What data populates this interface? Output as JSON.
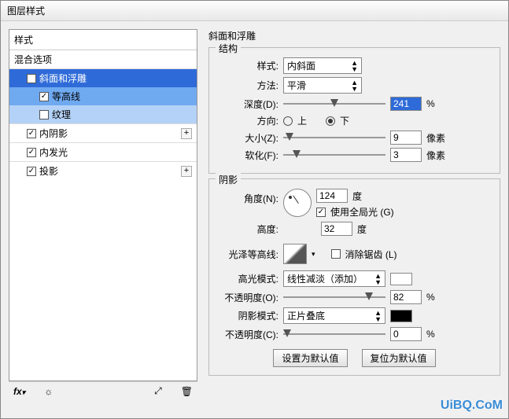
{
  "title": "图层样式",
  "left": {
    "header": "样式",
    "blend": "混合选项",
    "items": [
      {
        "label": "斜面和浮雕",
        "checked": true,
        "cls": "sel1 indent"
      },
      {
        "label": "等高线",
        "checked": true,
        "cls": "sel2 indent2"
      },
      {
        "label": "纹理",
        "checked": false,
        "cls": "sel3 indent2"
      },
      {
        "label": "内阴影",
        "checked": true,
        "cls": "sep indent",
        "plus": true
      },
      {
        "label": "内发光",
        "checked": true,
        "cls": "sep indent"
      },
      {
        "label": "投影",
        "checked": true,
        "cls": "sep indent",
        "plus": true
      }
    ],
    "footer_icons": [
      "fx",
      "sun",
      "chevron",
      "trash"
    ]
  },
  "section_title": "斜面和浮雕",
  "structure": {
    "title": "结构",
    "style_lbl": "样式:",
    "style_val": "内斜面",
    "method_lbl": "方法:",
    "method_val": "平滑",
    "depth_lbl": "深度(D):",
    "depth_val": "241",
    "depth_unit": "%",
    "dir_lbl": "方向:",
    "up": "上",
    "down": "下",
    "size_lbl": "大小(Z):",
    "size_val": "9",
    "size_unit": "像素",
    "soften_lbl": "软化(F):",
    "soften_val": "3",
    "soften_unit": "像素"
  },
  "shading": {
    "title": "阴影",
    "angle_lbl": "角度(N):",
    "angle_val": "124",
    "deg": "度",
    "use_global": "使用全局光 (G)",
    "altitude_lbl": "高度:",
    "altitude_val": "32",
    "gloss_lbl": "光泽等高线:",
    "antialias": "消除锯齿 (L)",
    "hi_mode_lbl": "高光模式:",
    "hi_mode_val": "线性减淡（添加）",
    "opacity_lbl": "不透明度(O):",
    "opacity_val": "82",
    "pct": "%",
    "sh_mode_lbl": "阴影模式:",
    "sh_mode_val": "正片叠底",
    "opacity2_lbl": "不透明度(C):",
    "opacity2_val": "0"
  },
  "buttons": {
    "default": "设置为默认值",
    "reset": "复位为默认值"
  },
  "watermark": "UiBQ.CoM"
}
